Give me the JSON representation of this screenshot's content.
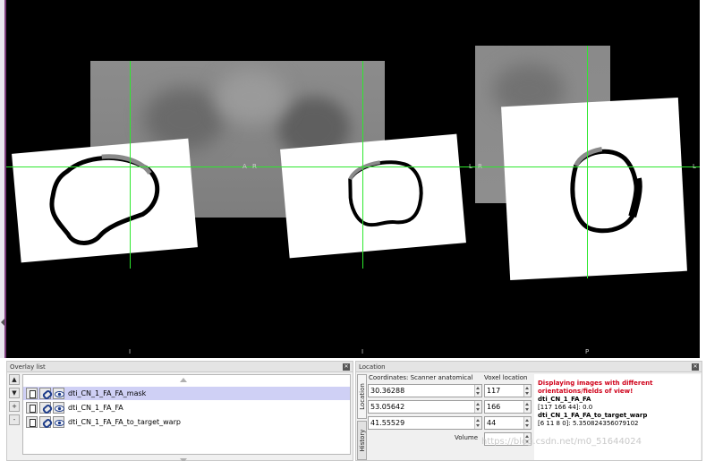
{
  "viewer": {
    "orientation_labels": {
      "view1_right": "A",
      "view2_left": "R",
      "view2_right": "L",
      "view3_left": "R",
      "view3_right": "L",
      "bottom1": "I",
      "bottom2": "I",
      "bottom3": "P"
    },
    "crosshair_color": "#2ee82e"
  },
  "overlay_panel": {
    "title": "Overlay list",
    "buttons": [
      "▲",
      "▼",
      "+",
      "-"
    ],
    "items": [
      {
        "label": "dti_CN_1_FA_FA_mask",
        "selected": true
      },
      {
        "label": "dti_CN_1_FA_FA",
        "selected": false
      },
      {
        "label": "dti_CN_1_FA_FA_to_target_warp",
        "selected": false
      }
    ]
  },
  "location_panel": {
    "title": "Location",
    "tabs": [
      "Location",
      "History"
    ],
    "coordinates_label": "Coordinates: Scanner anatomical",
    "voxel_label": "Voxel location",
    "volume_label": "Volume",
    "coordinates": [
      "30.36288",
      "53.05642",
      "41.55529"
    ],
    "voxels": [
      "117",
      "166",
      "44"
    ],
    "volume_value": "",
    "info": {
      "warning": "Displaying images with different orientations/fields of view!",
      "entries": [
        {
          "name": "dti_CN_1_FA_FA",
          "value": "[117 166 44]: 0.0"
        },
        {
          "name": "dti_CN_1_FA_FA_to_target_warp",
          "value": "[6 11 8 0]: 5.350824356079102"
        }
      ]
    }
  },
  "watermark": "https://blog.csdn.net/m0_51644024"
}
